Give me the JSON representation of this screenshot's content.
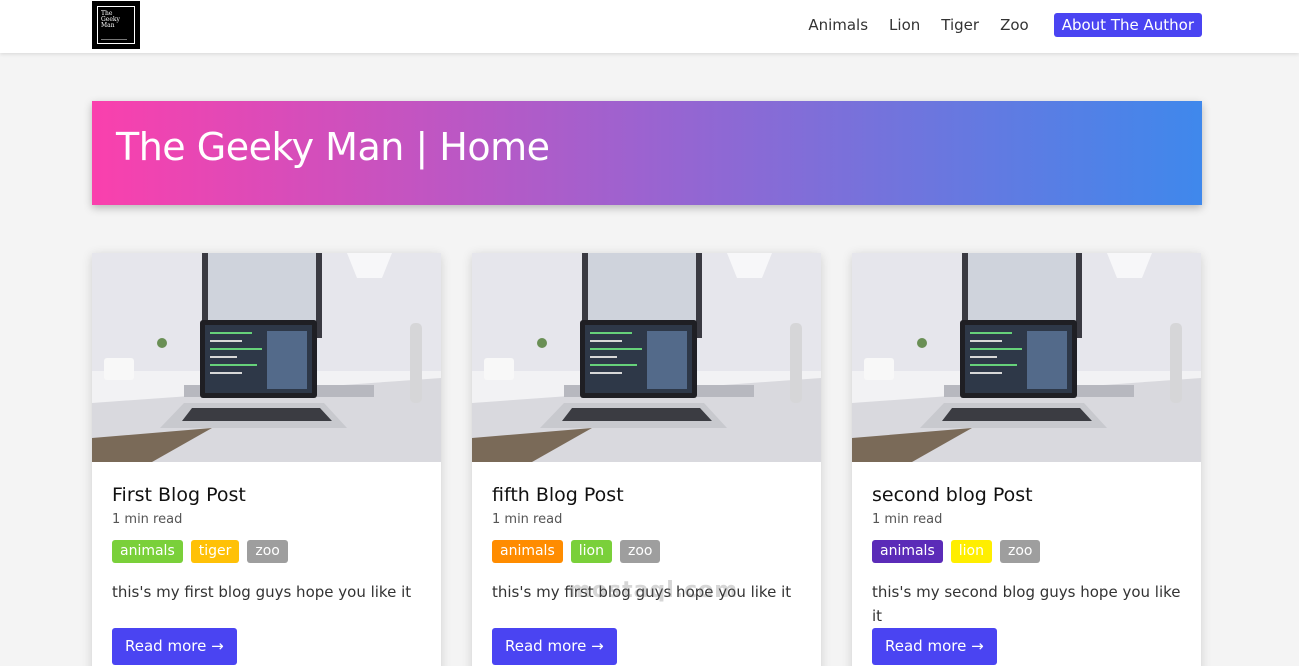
{
  "nav": {
    "logo_text": "The Geeky Man",
    "links": [
      {
        "label": "Animals"
      },
      {
        "label": "Lion"
      },
      {
        "label": "Tiger"
      },
      {
        "label": "Zoo"
      },
      {
        "label": "About The Author"
      }
    ]
  },
  "hero": {
    "title": "The Geeky Man | Home"
  },
  "posts": [
    {
      "title": "First Blog Post",
      "read_time": "1 min read",
      "tags": [
        {
          "label": "animals",
          "color": "#7ad03a"
        },
        {
          "label": "tiger",
          "color": "#ffc107"
        },
        {
          "label": "zoo",
          "color": "#9e9e9e"
        }
      ],
      "excerpt": "this's my first blog guys hope you like it",
      "button": "Read more →"
    },
    {
      "title": "fifth Blog Post",
      "read_time": "1 min read",
      "tags": [
        {
          "label": "animals",
          "color": "#ff8c00"
        },
        {
          "label": "lion",
          "color": "#7ad03a"
        },
        {
          "label": "zoo",
          "color": "#9e9e9e"
        }
      ],
      "excerpt": "this's my first blog guys hope you like it",
      "button": "Read more →"
    },
    {
      "title": "second blog Post",
      "read_time": "1 min read",
      "tags": [
        {
          "label": "animals",
          "color": "#5b2bb8"
        },
        {
          "label": "lion",
          "color": "#ffee00"
        },
        {
          "label": "zoo",
          "color": "#9e9e9e"
        }
      ],
      "excerpt": "this's my second blog guys hope you like it",
      "button": "Read more →"
    }
  ],
  "watermark": "mostaql.com",
  "colors": {
    "accent": "#4a44f2",
    "hero_start": "#fa40ad",
    "hero_end": "#3f88ec"
  }
}
